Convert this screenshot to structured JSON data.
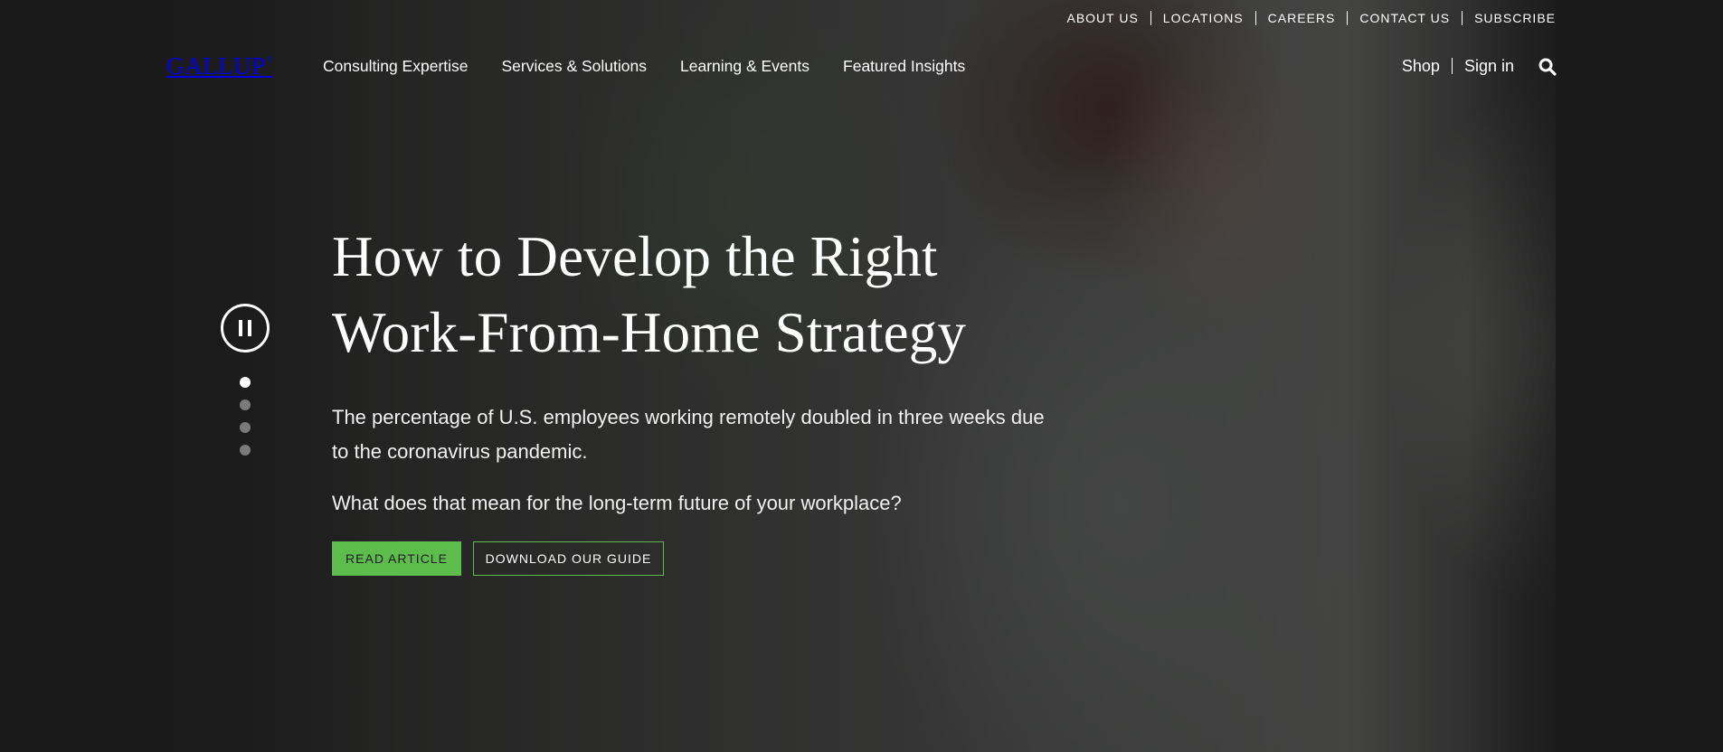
{
  "utility_nav": {
    "items": [
      "ABOUT US",
      "LOCATIONS",
      "CAREERS",
      "CONTACT US",
      "SUBSCRIBE"
    ]
  },
  "brand": {
    "logo_text": "GALLUP",
    "logo_mark": "®"
  },
  "main_nav": {
    "items": [
      "Consulting Expertise",
      "Services & Solutions",
      "Learning & Events",
      "Featured Insights"
    ]
  },
  "account_nav": {
    "shop": "Shop",
    "sign_in": "Sign in",
    "search_icon": "search-icon"
  },
  "carousel": {
    "pause_icon": "pause-icon",
    "slide_count": 4,
    "active_slide": 1
  },
  "hero": {
    "headline_line1": "How to Develop the Right",
    "headline_line2": "Work-From-Home Strategy",
    "subtext_1": "The percentage of U.S. employees working remotely doubled in three weeks due to the coronavirus pandemic.",
    "subtext_2": "What does that mean for the long-term future of your workplace?",
    "primary_cta": "READ ARTICLE",
    "secondary_cta": "DOWNLOAD OUR GUIDE"
  },
  "colors": {
    "accent": "#5cbd4c",
    "background": "#1e1e1e",
    "text": "#ffffff"
  }
}
